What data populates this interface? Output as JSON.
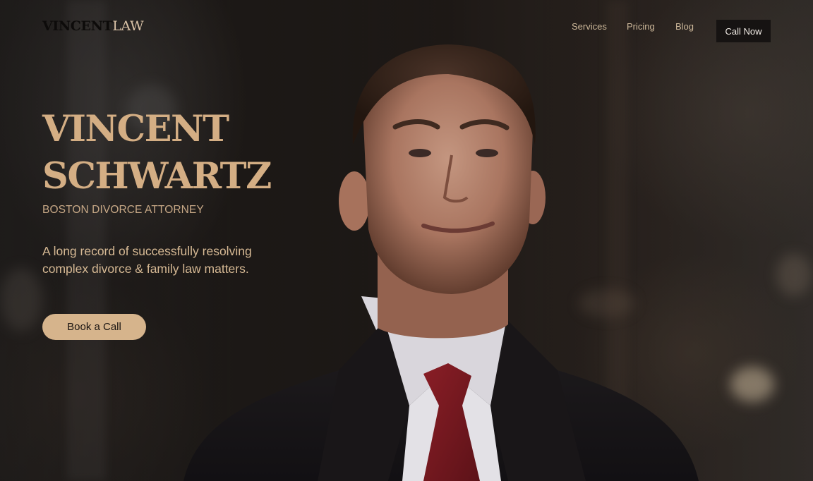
{
  "brand": {
    "logo_strong": "VINCENT",
    "logo_light": "LAW"
  },
  "nav": {
    "links": [
      "Services",
      "Pricing",
      "Blog"
    ],
    "cta_label": "Call Now"
  },
  "hero": {
    "name_line1": "VINCENT",
    "name_line2": "SCHWARTZ",
    "subtitle": "BOSTON DIVORCE ATTORNEY",
    "description": "A long record of successfully resolving complex divorce & family law matters.",
    "cta_label": "Book a Call"
  },
  "colors": {
    "accent": "#d4ae84",
    "button_bg": "#d6b48c",
    "nav_cta_bg": "#161312",
    "background": "#1d1815"
  }
}
